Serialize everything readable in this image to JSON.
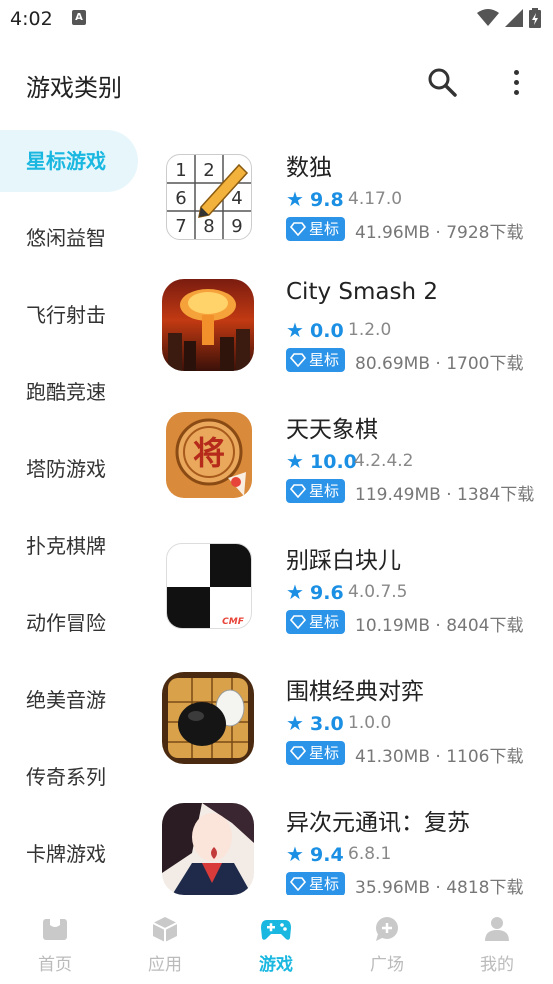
{
  "status_bar": {
    "time": "4:02",
    "notification_letter": "A"
  },
  "header": {
    "title": "游戏类别"
  },
  "sidebar": {
    "items": [
      {
        "label": "星标游戏",
        "active": true
      },
      {
        "label": "悠闲益智",
        "active": false
      },
      {
        "label": "飞行射击",
        "active": false
      },
      {
        "label": "跑酷竞速",
        "active": false
      },
      {
        "label": "塔防游戏",
        "active": false
      },
      {
        "label": "扑克棋牌",
        "active": false
      },
      {
        "label": "动作冒险",
        "active": false
      },
      {
        "label": "绝美音游",
        "active": false
      },
      {
        "label": "传奇系列",
        "active": false
      },
      {
        "label": "卡牌游戏",
        "active": false
      }
    ]
  },
  "badge_label": "星标",
  "games": [
    {
      "name": "数独",
      "rating": "9.8",
      "version": "4.17.0",
      "meta": "41.96MB · 7928下载",
      "icon": "sudoku-icon"
    },
    {
      "name": "City Smash 2",
      "rating": "0.0",
      "version": "1.2.0",
      "meta": "80.69MB · 1700下载",
      "icon": "city-smash-icon"
    },
    {
      "name": "天天象棋",
      "rating": "10.0",
      "version": "4.2.4.2",
      "meta": "119.49MB · 1384下载",
      "icon": "xiangqi-icon",
      "icon_glyph": "将"
    },
    {
      "name": "别踩白块儿",
      "rating": "9.6",
      "version": "4.0.7.5",
      "meta": "10.19MB · 8404下载",
      "icon": "piano-tiles-icon"
    },
    {
      "name": "围棋经典对弈",
      "rating": "3.0",
      "version": "1.0.0",
      "meta": "41.30MB · 1106下载",
      "icon": "go-game-icon"
    },
    {
      "name": "异次元通讯：复苏",
      "rating": "9.4",
      "version": "6.8.1",
      "meta": "35.96MB · 4818下载",
      "icon": "anime-girl-icon"
    }
  ],
  "sudoku_digits": [
    "1",
    "2",
    "6",
    "4",
    "7",
    "8",
    "9"
  ],
  "bottom_nav": [
    {
      "label": "首页",
      "icon": "home-icon",
      "active": false
    },
    {
      "label": "应用",
      "icon": "box-icon",
      "active": false
    },
    {
      "label": "游戏",
      "icon": "gamepad-icon",
      "active": true
    },
    {
      "label": "广场",
      "icon": "chat-icon",
      "active": false
    },
    {
      "label": "我的",
      "icon": "person-icon",
      "active": false
    }
  ],
  "colors": {
    "accent": "#1ab8e0",
    "rating_blue": "#1a8fe3",
    "badge_blue": "#2c94e8",
    "sidebar_active_bg": "#e6f6fb"
  }
}
